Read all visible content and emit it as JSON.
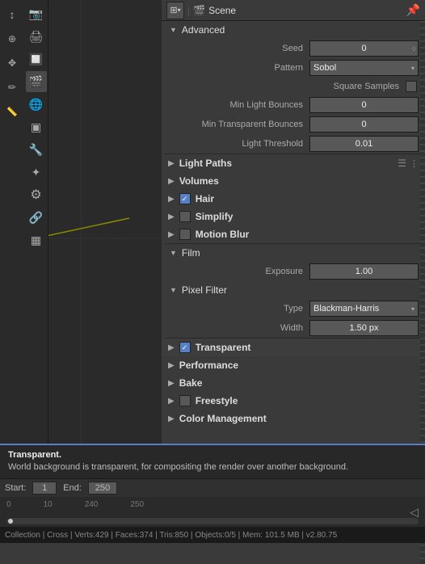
{
  "topbar": {
    "dropdown_label": "▾",
    "scene_icon": "🎬",
    "title": "Scene",
    "pin_icon": "📌"
  },
  "advanced": {
    "header_arrow": "▼",
    "header_label": "Advanced",
    "seed_label": "Seed",
    "seed_value": "0",
    "pattern_label": "Pattern",
    "pattern_value": "Sobol",
    "pattern_dropdown": "▾",
    "square_samples_label": "Square Samples",
    "min_light_bounces_label": "Min Light Bounces",
    "min_light_bounces_value": "0",
    "min_transparent_bounces_label": "Min Transparent Bounces",
    "min_transparent_bounces_value": "0",
    "light_threshold_label": "Light Threshold",
    "light_threshold_value": "0.01"
  },
  "sections": [
    {
      "id": "light-paths",
      "arrow": "▶",
      "label": "Light Paths",
      "has_list_icon": true
    },
    {
      "id": "volumes",
      "arrow": "▶",
      "label": "Volumes",
      "has_list_icon": false
    },
    {
      "id": "hair",
      "arrow": "▶",
      "label": "Hair",
      "checkbox": true,
      "checkbox_checked": true,
      "has_list_icon": false
    },
    {
      "id": "simplify",
      "arrow": "▶",
      "label": "Simplify",
      "checkbox": true,
      "checkbox_checked": false,
      "has_list_icon": false
    },
    {
      "id": "motion-blur",
      "arrow": "▶",
      "label": "Motion Blur",
      "checkbox": true,
      "checkbox_checked": false,
      "has_list_icon": false
    }
  ],
  "film": {
    "header_arrow": "▼",
    "header_label": "Film",
    "exposure_label": "Exposure",
    "exposure_value": "1.00"
  },
  "pixel_filter": {
    "header_arrow": "▼",
    "header_label": "Pixel Filter",
    "type_label": "Type",
    "type_value": "Blackman-Harris",
    "type_dropdown": "▾",
    "width_label": "Width",
    "width_value": "1.50 px"
  },
  "transparent": {
    "arrow": "▶",
    "label": "Transparent",
    "checkbox_checked": true
  },
  "performance": {
    "arrow": "▶",
    "label": "Performance"
  },
  "bake": {
    "arrow": "▶",
    "label": "Bake"
  },
  "freestyle": {
    "arrow": "▶",
    "label": "Freestyle",
    "checkbox": true,
    "checkbox_checked": false
  },
  "color_management": {
    "arrow": "▶",
    "label": "Color Management"
  },
  "tooltip": {
    "title": "Transparent.",
    "description": "World background is transparent, for compositing the render over another background."
  },
  "timeline": {
    "start_label": "Start:",
    "start_value": "1",
    "end_label": "End:",
    "end_value": "250",
    "markers": [
      "0",
      "10",
      "240",
      "250"
    ]
  },
  "status_bar": {
    "text": "Collection | Cross | Verts:429 | Faces:374 | Tris:850 | Objects:0/5 | Mem: 101.5 MB | v2.80.75"
  },
  "sidebar_icons": [
    {
      "id": "render",
      "icon": "📷"
    },
    {
      "id": "output",
      "icon": "🖨"
    },
    {
      "id": "view-layer",
      "icon": "🔲"
    },
    {
      "id": "scene",
      "icon": "🎬",
      "active": true
    },
    {
      "id": "world",
      "icon": "🌐"
    },
    {
      "id": "object",
      "icon": "▣"
    },
    {
      "id": "modifier",
      "icon": "🔧"
    },
    {
      "id": "particles",
      "icon": "✦"
    },
    {
      "id": "physics",
      "icon": "⚙"
    },
    {
      "id": "constraints",
      "icon": "🔗"
    },
    {
      "id": "data",
      "icon": "📊"
    }
  ],
  "colors": {
    "accent_blue": "#5680c2",
    "bg_dark": "#2a2a2a",
    "bg_panel": "#3a3a3a",
    "bg_field": "#585858",
    "text_label": "#aaaaaa",
    "text_value": "#eeeeee"
  }
}
